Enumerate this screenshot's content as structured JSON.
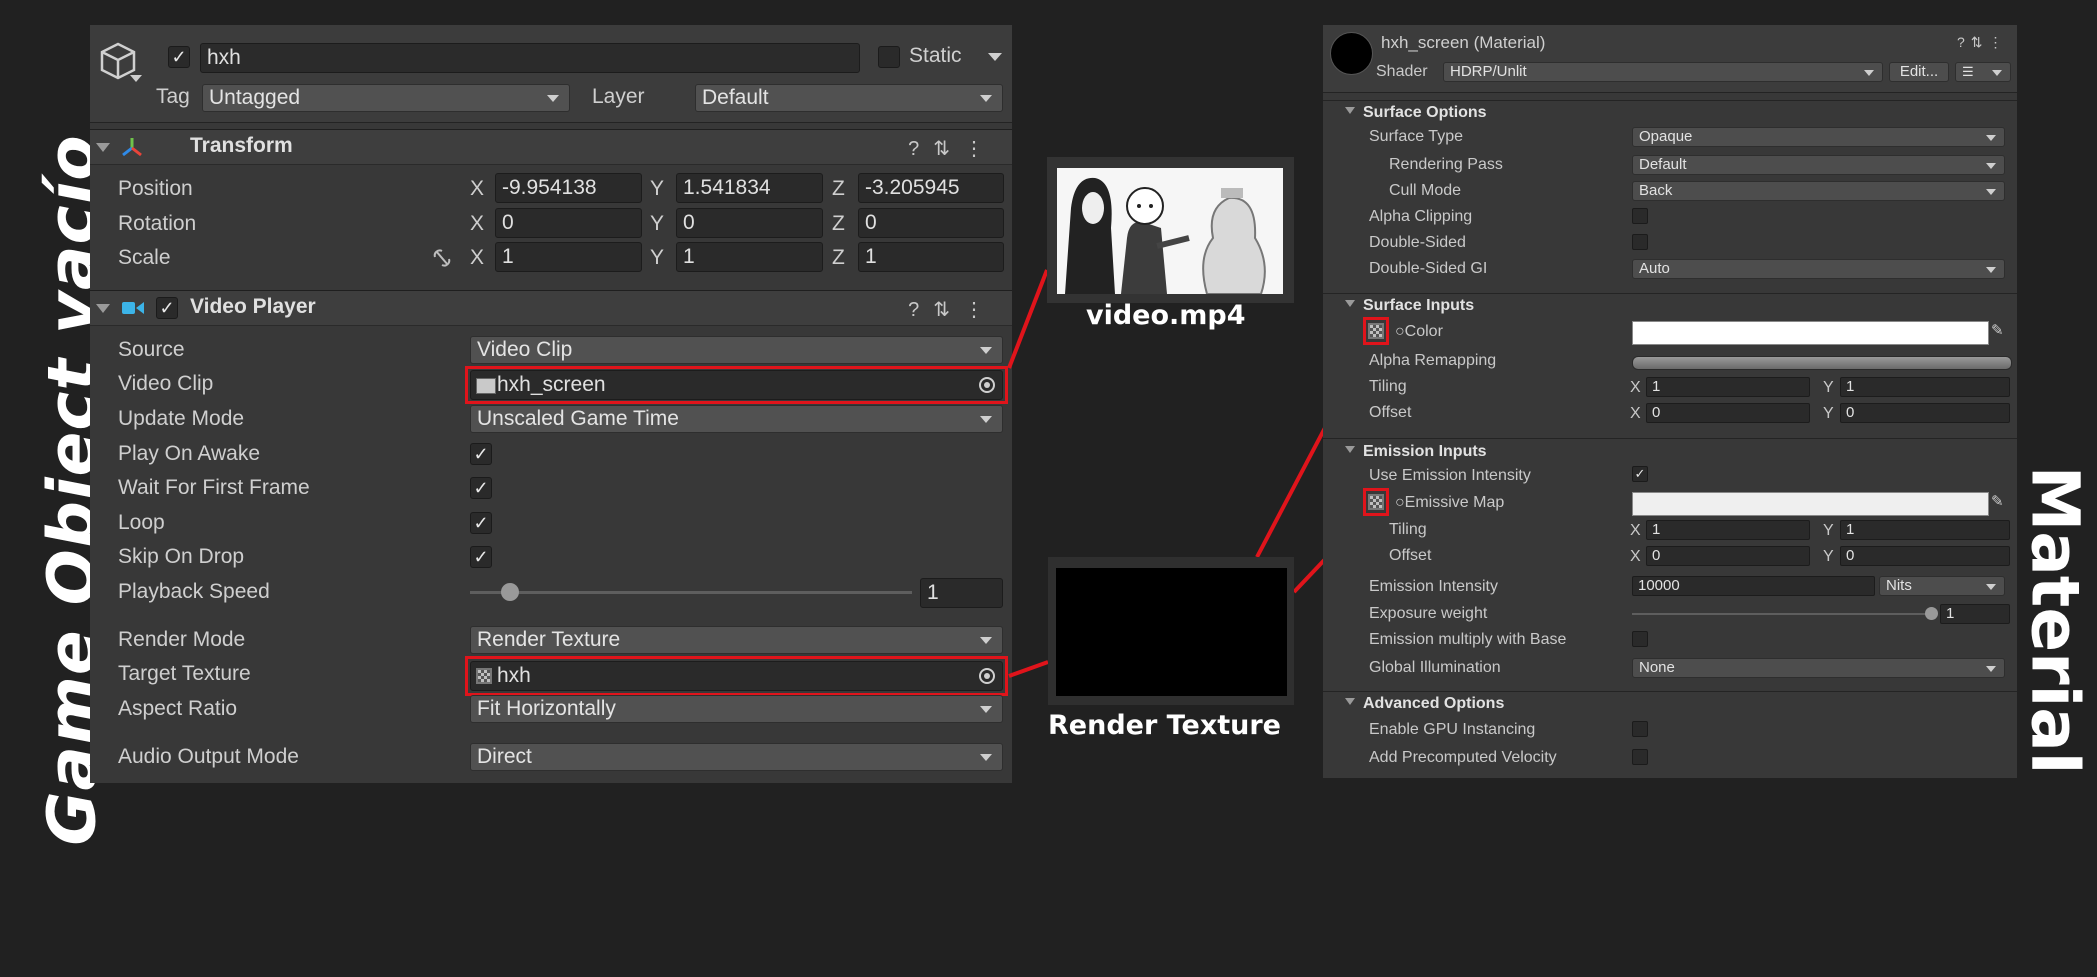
{
  "side_labels": {
    "left": "Game Object vacío",
    "right": "Material"
  },
  "game_object": {
    "name": "hxh",
    "active": true,
    "static_label": "Static",
    "tag_label": "Tag",
    "tag_value": "Untagged",
    "layer_label": "Layer",
    "layer_value": "Default"
  },
  "transform": {
    "title": "Transform",
    "rows": [
      {
        "label": "Position",
        "x": "-9.954138",
        "y": "1.541834",
        "z": "-3.205945"
      },
      {
        "label": "Rotation",
        "x": "0",
        "y": "0",
        "z": "0"
      },
      {
        "label": "Scale",
        "x": "1",
        "y": "1",
        "z": "1"
      }
    ],
    "axis": {
      "x": "X",
      "y": "Y",
      "z": "Z"
    }
  },
  "video_player": {
    "title": "Video Player",
    "source_label": "Source",
    "source_value": "Video Clip",
    "clip_label": "Video Clip",
    "clip_value": "hxh_screen",
    "update_label": "Update Mode",
    "update_value": "Unscaled Game Time",
    "play_on_awake_label": "Play On Awake",
    "play_on_awake": true,
    "wait_label": "Wait For First Frame",
    "wait": true,
    "loop_label": "Loop",
    "loop": true,
    "skip_label": "Skip On Drop",
    "skip": true,
    "speed_label": "Playback Speed",
    "speed_value": "1",
    "speed_fraction": 0.09,
    "render_mode_label": "Render Mode",
    "render_mode_value": "Render Texture",
    "target_label": "Target Texture",
    "target_value": "hxh",
    "aspect_label": "Aspect Ratio",
    "aspect_value": "Fit Horizontally",
    "audio_label": "Audio Output Mode",
    "audio_value": "Direct"
  },
  "captions": {
    "video": "video.mp4",
    "render_texture": "Render Texture"
  },
  "material": {
    "title": "hxh_screen (Material)",
    "shader_label": "Shader",
    "shader_value": "HDRP/Unlit",
    "edit_label": "Edit...",
    "surface_options": {
      "title": "Surface Options",
      "surface_type_label": "Surface Type",
      "surface_type": "Opaque",
      "rendering_pass_label": "Rendering Pass",
      "rendering_pass": "Default",
      "cull_mode_label": "Cull Mode",
      "cull_mode": "Back",
      "alpha_clipping_label": "Alpha Clipping",
      "double_sided_label": "Double-Sided",
      "double_sided_gi_label": "Double-Sided GI",
      "double_sided_gi": "Auto"
    },
    "surface_inputs": {
      "title": "Surface Inputs",
      "color_label": "Color",
      "alpha_remap_label": "Alpha Remapping",
      "tiling_label": "Tiling",
      "tiling_x": "1",
      "tiling_y": "1",
      "offset_label": "Offset",
      "offset_x": "0",
      "offset_y": "0"
    },
    "emission_inputs": {
      "title": "Emission Inputs",
      "use_intensity_label": "Use Emission Intensity",
      "use_intensity": true,
      "emissive_map_label": "Emissive Map",
      "tiling_label": "Tiling",
      "tiling_x": "1",
      "tiling_y": "1",
      "offset_label": "Offset",
      "offset_x": "0",
      "offset_y": "0",
      "intensity_label": "Emission Intensity",
      "intensity_value": "10000",
      "intensity_unit": "Nits",
      "exposure_label": "Exposure weight",
      "exposure_value": "1",
      "exposure_fraction": 1.0,
      "multiply_label": "Emission multiply with Base",
      "gi_label": "Global Illumination",
      "gi_value": "None"
    },
    "advanced": {
      "title": "Advanced Options",
      "gpu_label": "Enable GPU Instancing",
      "velocity_label": "Add Precomputed Velocity"
    },
    "axis": {
      "x": "X",
      "y": "Y"
    }
  },
  "colors": {
    "highlight": "#e0141b",
    "panel": "#383838",
    "background": "#212121"
  }
}
